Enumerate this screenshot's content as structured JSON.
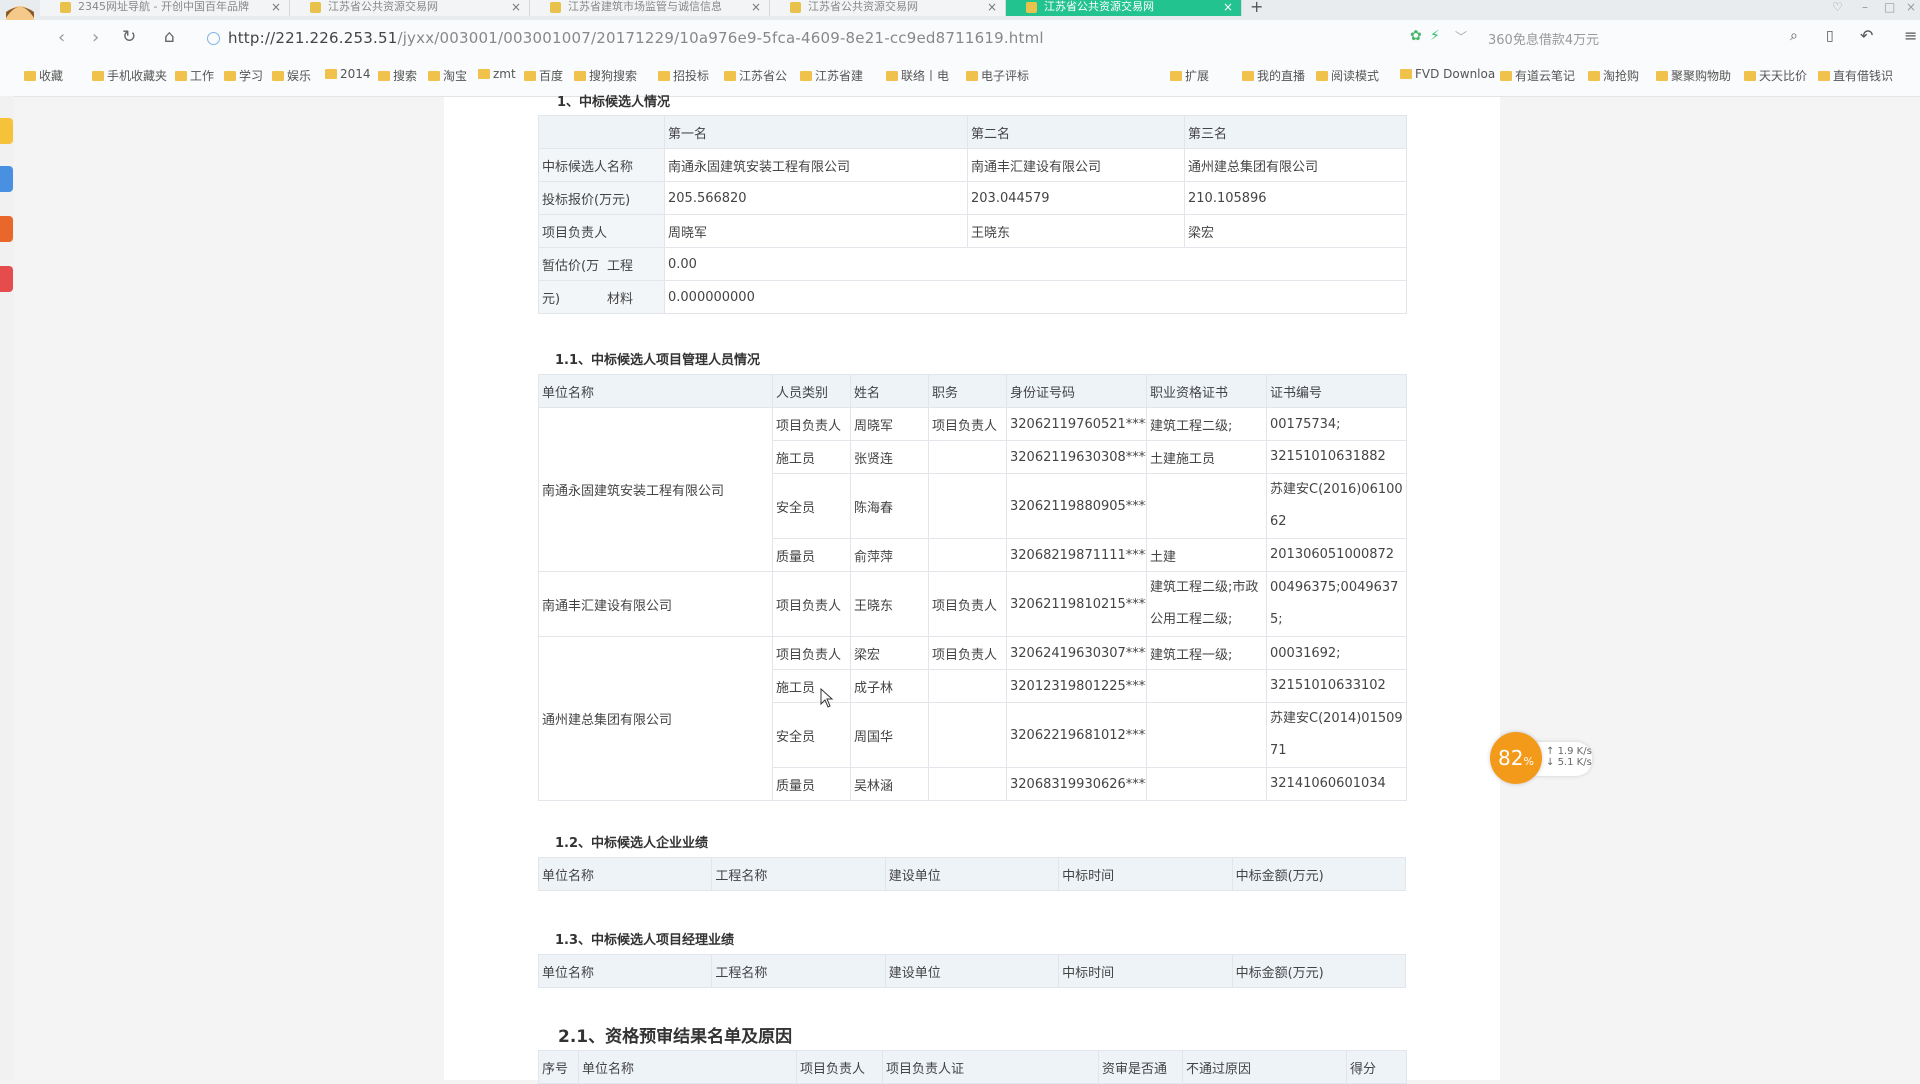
{
  "browser": {
    "tabs": [
      {
        "label": "2345网址导航 - 开创中国百年品牌"
      },
      {
        "label": "江苏省公共资源交易网"
      },
      {
        "label": "江苏省建筑市场监管与诚信信息"
      },
      {
        "label": "江苏省公共资源交易网"
      },
      {
        "label": "江苏省公共资源交易网",
        "active": true
      }
    ],
    "url_host": "http://221.226.253.51",
    "url_path": "/jyxx/003001/003001007/20171229/10a976e9-5fca-4609-8e21-cc9ed8711619.html",
    "search_placeholder": "360免息借款4万元",
    "bookmarks": [
      "收藏",
      "手机收藏夹",
      "工作",
      "学习",
      "娱乐",
      "2014",
      "搜索",
      "淘宝",
      "zmt",
      "百度",
      "搜狗搜索",
      "招投标",
      "江苏省公",
      "江苏省建",
      "联络丨电",
      "电子评标",
      "扩展",
      "我的直播",
      "阅读模式",
      "FVD Downloa",
      "有道云笔记",
      "淘抢购",
      "聚聚购物助",
      "天天比价",
      "直有借钱识"
    ]
  },
  "section1": {
    "heading": "1、中标候选人情况",
    "header": [
      "",
      "第一名",
      "第二名",
      "第三名"
    ],
    "rows": [
      {
        "label": "中标候选人名称",
        "v1": "南通永固建筑安装工程有限公司",
        "v2": "南通丰汇建设有限公司",
        "v3": "通州建总集团有限公司"
      },
      {
        "label": "投标报价(万元)",
        "v1": "205.566820",
        "v2": "203.044579",
        "v3": "210.105896"
      },
      {
        "label": "项目负责人",
        "v1": "周晓军",
        "v2": "王晓东",
        "v3": "梁宏"
      }
    ],
    "provisional_label_a": "暂估价(万",
    "provisional_label_b": "元)",
    "project_label": "工程",
    "project_value": "0.00",
    "material_label": "材料",
    "material_value": "0.000000000"
  },
  "section11": {
    "heading": "1.1、中标候选人项目管理人员情况",
    "header": [
      "单位名称",
      "人员类别",
      "姓名",
      "职务",
      "身份证号码",
      "职业资格证书",
      "证书编号"
    ],
    "companies": [
      {
        "name": "南通永固建筑安装工程有限公司",
        "people": [
          {
            "type": "项目负责人",
            "name": "周晓军",
            "role": "项目负责人",
            "id": "32062119760521****",
            "cert": "建筑工程二级;",
            "cert_no": "00175734;"
          },
          {
            "type": "施工员",
            "name": "张贤连",
            "role": "",
            "id": "32062119630308****",
            "cert": "土建施工员",
            "cert_no": "32151010631882"
          },
          {
            "type": "安全员",
            "name": "陈海春",
            "role": "",
            "id": "32062119880905****",
            "cert": "",
            "cert_no": "苏建安C(2016)0610062"
          },
          {
            "type": "质量员",
            "name": "俞萍萍",
            "role": "",
            "id": "32068219871111****",
            "cert": "土建",
            "cert_no": "201306051000872"
          }
        ]
      },
      {
        "name": "南通丰汇建设有限公司",
        "people": [
          {
            "type": "项目负责人",
            "name": "王晓东",
            "role": "项目负责人",
            "id": "32062119810215****",
            "cert": "建筑工程二级;市政公用工程二级;",
            "cert_no": "00496375;00496375;"
          }
        ]
      },
      {
        "name": "通州建总集团有限公司",
        "people": [
          {
            "type": "项目负责人",
            "name": "梁宏",
            "role": "项目负责人",
            "id": "32062419630307****",
            "cert": "建筑工程一级;",
            "cert_no": "00031692;"
          },
          {
            "type": "施工员",
            "name": "成子林",
            "role": "",
            "id": "32012319801225****",
            "cert": "",
            "cert_no": "32151010633102"
          },
          {
            "type": "安全员",
            "name": "周国华",
            "role": "",
            "id": "32062219681012****",
            "cert": "",
            "cert_no": "苏建安C(2014)0150971"
          },
          {
            "type": "质量员",
            "name": "吴林涵",
            "role": "",
            "id": "32068319930626****",
            "cert": "",
            "cert_no": "32141060601034"
          }
        ]
      }
    ]
  },
  "section12": {
    "heading": "1.2、中标候选人企业业绩",
    "header": [
      "单位名称",
      "工程名称",
      "建设单位",
      "中标时间",
      "中标金额(万元)"
    ]
  },
  "section13": {
    "heading": "1.3、中标候选人项目经理业绩",
    "header": [
      "单位名称",
      "工程名称",
      "建设单位",
      "中标时间",
      "中标金额(万元)"
    ]
  },
  "section21": {
    "heading": "2.1、资格预审结果名单及原因",
    "partial_header": [
      "序号",
      "单位名称",
      "项目负责人",
      "项目负责人证",
      "资审是否通",
      "不通过原因",
      "得分"
    ]
  },
  "widget": {
    "percent": "82",
    "percent_unit": "%",
    "up": "1.9 K/s",
    "down": "5.1 K/s"
  }
}
